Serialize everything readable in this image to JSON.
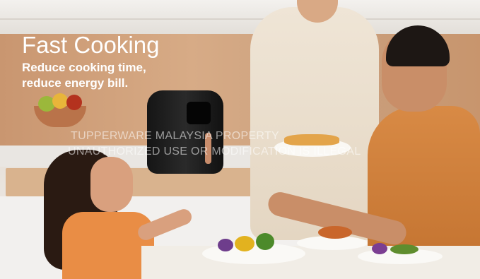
{
  "ad": {
    "headline": "Fast Cooking",
    "subline_1": "Reduce cooking time,",
    "subline_2": "reduce energy bill."
  },
  "watermark": {
    "line_1": "TUPPERWARE MALAYSIA PROPERTY",
    "line_2": "UNAUTHORIZED USE OR MODIFICATION IS ILLEGAL"
  },
  "colors": {
    "headline_text": "#ffffff",
    "air_fryer_body": "#1c1c1c",
    "air_fryer_handle": "#c88c6b",
    "wood_wall": "#d7ab86"
  }
}
